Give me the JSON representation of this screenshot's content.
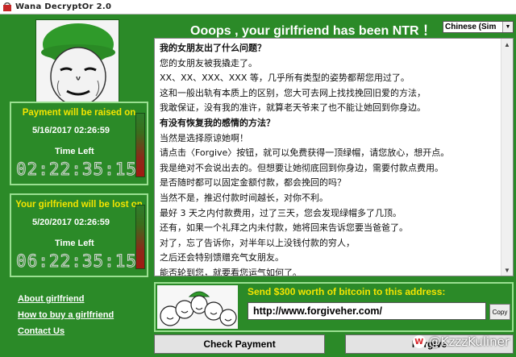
{
  "window": {
    "title": "Wana DecryptOr 2.0"
  },
  "headline": "Ooops , your girlfriend has been NTR ！",
  "language": {
    "selected": "Chinese (Sim"
  },
  "message": {
    "lines": [
      {
        "text": "我的女朋友出了什么问题？",
        "bold": true
      },
      {
        "text": "您的女朋友被我撬走了。",
        "bold": false
      },
      {
        "text": "XX、XX、XXX、XXX 等，几乎所有类型的姿势都帮您用过了。",
        "bold": false
      },
      {
        "text": "这和一般出轨有本质上的区别，您大可去网上找找挽回旧爱的方法，",
        "bold": false
      },
      {
        "text": "我敢保证，没有我的准许，就算老天爷来了也不能让她回到你身边。",
        "bold": false
      },
      {
        "text": "有没有恢复我的感情的方法？",
        "bold": true
      },
      {
        "text": "当然是选择原谅她啊！",
        "bold": false
      },
      {
        "text": "请点击〈Forgive〉按钮，就可以免费获得一顶绿帽，请您放心，想开点。",
        "bold": false
      },
      {
        "text": "我是绝对不会说出去的。但想要让她彻底回到你身边，需要付款点费用。",
        "bold": false
      },
      {
        "text": "是否随时都可以固定金额付款，都会挽回的吗？",
        "bold": false
      },
      {
        "text": "当然不是，推迟付款时间越长，对你不利。",
        "bold": false
      },
      {
        "text": "最好 3 天之内付款费用，过了三天，您会发现绿帽多了几顶。",
        "bold": false
      },
      {
        "text": "还有，如果一个礼拜之内未付款，她将回来告诉您要当爸爸了。",
        "bold": false
      },
      {
        "text": "对了，忘了告诉你，对半年以上没钱付款的穷人，",
        "bold": false
      },
      {
        "text": "之后还会特别馈赠充气女朋友。",
        "bold": false
      },
      {
        "text": "能否轮到您，就要看您运气如何了。",
        "bold": false
      }
    ]
  },
  "timer1": {
    "heading": "Payment will be raised on",
    "date": "5/16/2017 02:26:59",
    "label": "Time Left",
    "countdown": "02:22:35:15"
  },
  "timer2": {
    "heading": "Your girlfriend will be lost on",
    "date": "5/20/2017 02:26:59",
    "label": "Time Left",
    "countdown": "06:22:35:15"
  },
  "links": {
    "about": "About girlfriend",
    "howto": "How to buy a girlfriend",
    "contact": "Contact Us"
  },
  "payment": {
    "send_text": "Send $300 worth of bitcoin to this address:",
    "address": "http://www.forgiveher.com/",
    "copy_label": "Copy"
  },
  "buttons": {
    "check": "Check Payment",
    "forgive": "Forgive"
  },
  "watermark": "@KzzzKuliner",
  "colors": {
    "background": "#2b8a28",
    "accent_yellow": "#f5e500",
    "frame": "#9adf91"
  }
}
